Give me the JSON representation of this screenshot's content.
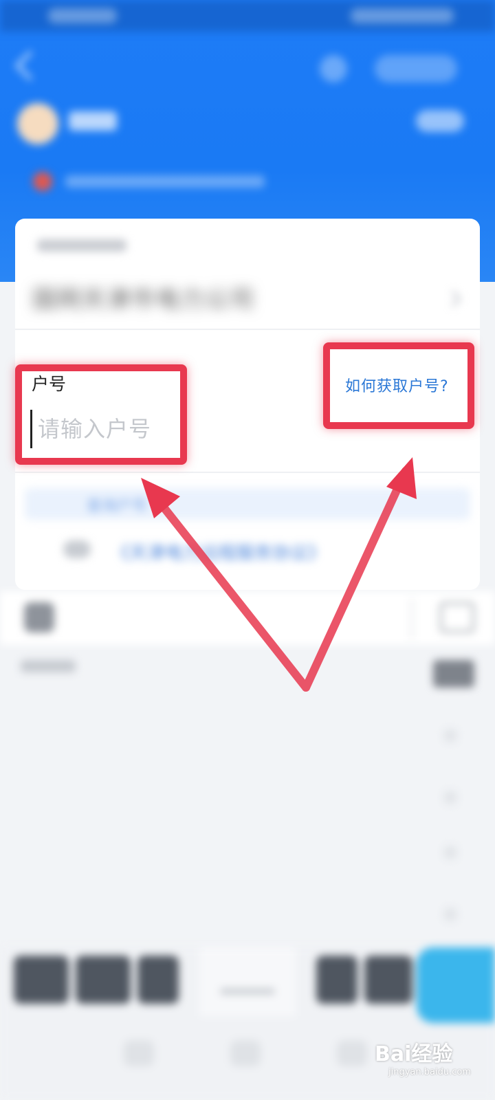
{
  "header": {
    "notice_text": ""
  },
  "card": {
    "company_name": "国网天津市电力公司",
    "account_label": "户号",
    "account_placeholder": "请输入户号",
    "how_to_get_link": "如何获取户号?",
    "query_text": "查询户号",
    "agreement_text": "《天津电力远程服务协议》"
  },
  "watermark": {
    "logo": "Bai经验",
    "site": "jingyan.baidu.com"
  },
  "colors": {
    "brand_blue": "#1e7cf7",
    "link_blue": "#2a77d6",
    "annotation_red": "#e8384f",
    "accent_cyan": "#3bb6ec"
  },
  "icons": [
    "back-icon",
    "avatar",
    "notice-icon",
    "chevron-right-icon",
    "message-icon"
  ]
}
